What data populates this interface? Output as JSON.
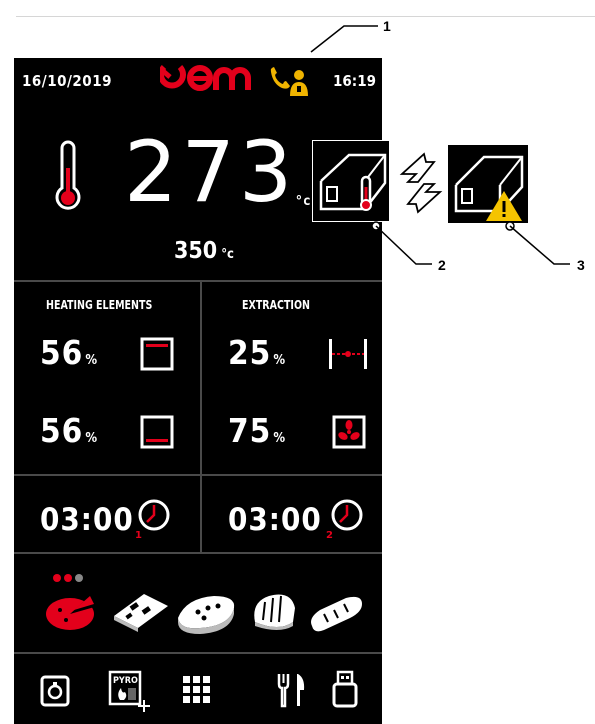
{
  "status_bar": {
    "date": "16/10/2019",
    "brand": "Oem",
    "time": "16:19",
    "brand_color": "#e3001b",
    "service_icon": "phone-technician-icon",
    "service_icon_color": "#f0b400"
  },
  "temperature": {
    "current": "273",
    "current_unit": "°c",
    "setpoint": "350",
    "setpoint_unit": "°c"
  },
  "heating_elements": {
    "title": "HEATING ELEMENTS",
    "top": {
      "value": "56",
      "unit": "%",
      "icon": "top-heater-icon"
    },
    "bottom": {
      "value": "56",
      "unit": "%",
      "icon": "bottom-heater-icon"
    }
  },
  "extraction": {
    "title": "EXTRACTION",
    "damper": {
      "value": "25",
      "unit": "%",
      "icon": "damper-icon"
    },
    "fan": {
      "value": "75",
      "unit": "%",
      "icon": "fan-icon"
    }
  },
  "timers": [
    {
      "value": "03:00",
      "index": "1",
      "icon": "clock-icon"
    },
    {
      "value": "03:00",
      "index": "2",
      "icon": "clock-icon"
    }
  ],
  "recipes": [
    "pizza-icon",
    "tray-icon",
    "pastry-icon",
    "bread-icon",
    "baguette-icon"
  ],
  "bottom_bar": [
    "lamp-icon",
    "pyro-icon",
    "grid-menu-icon",
    "cutlery-icon",
    "usb-icon"
  ],
  "bottom_bar_pyro_label": "PYRO",
  "callouts": {
    "one": "1",
    "two": "2",
    "three": "3"
  },
  "warning_color": "#f5c400"
}
